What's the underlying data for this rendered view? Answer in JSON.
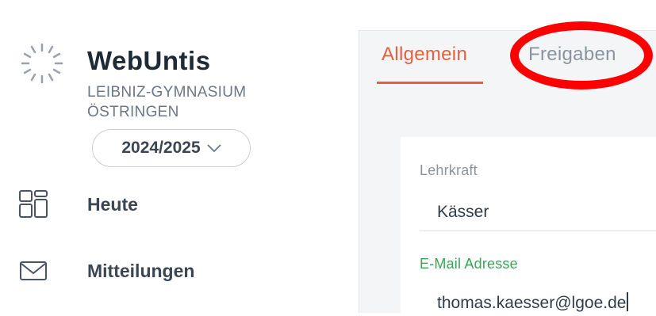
{
  "app": {
    "name": "WebUntis",
    "school_line1": "LEIBNIZ-GYMNASIUM",
    "school_line2": "ÖSTRINGEN",
    "school_year": "2024/2025"
  },
  "sidebar": {
    "items": [
      {
        "label": "Heute",
        "icon": "dashboard-grid-icon"
      },
      {
        "label": "Mitteilungen",
        "icon": "envelope-icon"
      }
    ]
  },
  "tabs": [
    {
      "label": "Allgemein",
      "active": true
    },
    {
      "label": "Freigaben",
      "active": false
    }
  ],
  "form": {
    "teacher_label": "Lehrkraft",
    "teacher_value": "Kässer",
    "email_label": "E-Mail Adresse",
    "email_value": "thomas.kaesser@lgoe.de"
  },
  "colors": {
    "accent": "#e85f3c",
    "email_label": "#3aa655",
    "highlight_ring": "#ff0000"
  }
}
